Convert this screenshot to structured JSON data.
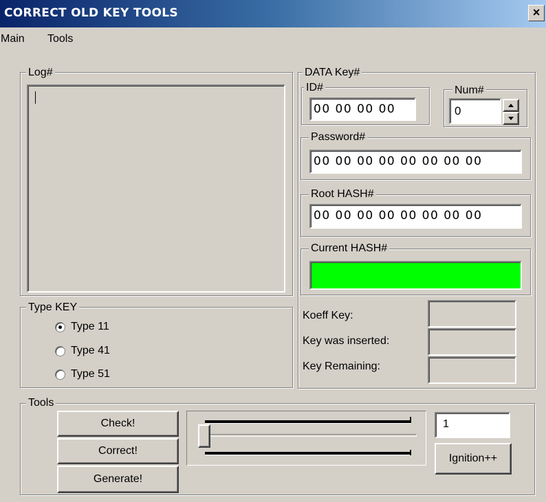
{
  "window": {
    "title": "CORRECT OLD KEY TOOLS",
    "close_glyph": "×"
  },
  "menu": {
    "items": [
      "Main",
      "Tools"
    ]
  },
  "log": {
    "label": "Log#",
    "text": ""
  },
  "data_key": {
    "label": "DATA Key#",
    "id": {
      "label": "ID#",
      "value": "00 00 00 00"
    },
    "num": {
      "label": "Num#",
      "value": "0"
    },
    "password": {
      "label": "Password#",
      "value": "00 00 00 00 00 00 00 00"
    },
    "root_hash": {
      "label": "Root HASH#",
      "value": "00 00 00 00 00 00 00 00"
    },
    "current_hash": {
      "label": "Current HASH#",
      "value": "",
      "color": "#00ff00"
    }
  },
  "type_key": {
    "label": "Type KEY",
    "options": [
      {
        "label": "Type 11",
        "checked": true
      },
      {
        "label": "Type 41",
        "checked": false
      },
      {
        "label": "Type 51",
        "checked": false
      }
    ]
  },
  "stats": [
    {
      "label": "Koeff Key:",
      "value": ""
    },
    {
      "label": "Key was inserted:",
      "value": ""
    },
    {
      "label": "Key Remaining:",
      "value": ""
    }
  ],
  "tools": {
    "label": "Tools",
    "check_label": "Check!",
    "correct_label": "Correct!",
    "generate_label": "Generate!",
    "slider_value": 0,
    "count_value": "1",
    "ignition_label": "Ignition++"
  }
}
